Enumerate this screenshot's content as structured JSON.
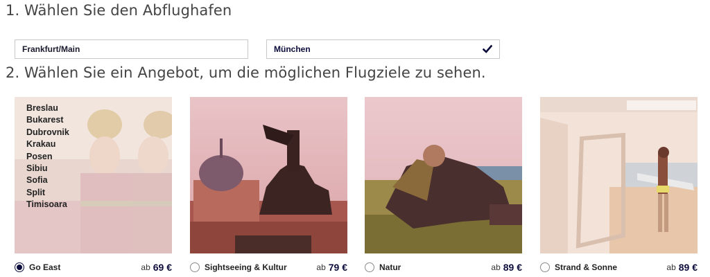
{
  "steps": {
    "step1": "1. Wählen Sie den Abflughafen",
    "step2": "2. Wählen Sie ein Angebot, um die möglichen Flugziele zu sehen."
  },
  "airports": {
    "origin": "Frankfurt/Main",
    "destination": "München",
    "destination_icon": "check-icon"
  },
  "offers": [
    {
      "name": "Go East",
      "price_prefix": "ab",
      "price": "69 €",
      "selected": true,
      "destinations": [
        "Breslau",
        "Bukarest",
        "Dubrovnik",
        "Krakau",
        "Posen",
        "Sibiu",
        "Sofia",
        "Split",
        "Timisoara"
      ]
    },
    {
      "name": "Sightseeing & Kultur",
      "price_prefix": "ab",
      "price": "79 €",
      "selected": false
    },
    {
      "name": "Natur",
      "price_prefix": "ab",
      "price": "89 €",
      "selected": false
    },
    {
      "name": "Strand & Sonne",
      "price_prefix": "ab",
      "price": "89 €",
      "selected": false
    }
  ],
  "colors": {
    "accent": "#0c0c3c",
    "border": "#c9c9c9",
    "text": "#444444"
  }
}
